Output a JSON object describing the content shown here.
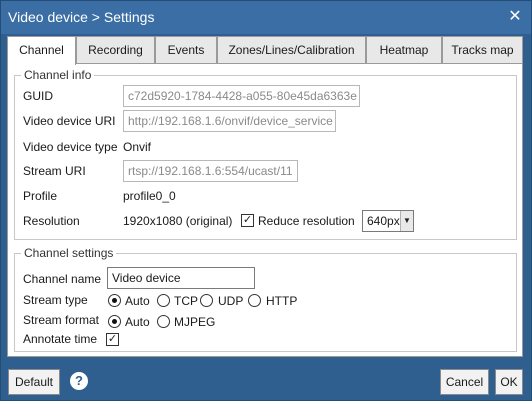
{
  "window": {
    "title": "Video device > Settings",
    "close_glyph": "✕"
  },
  "tabs": [
    {
      "label": "Channel",
      "active": true
    },
    {
      "label": "Recording",
      "active": false
    },
    {
      "label": "Events",
      "active": false
    },
    {
      "label": "Zones/Lines/Calibration",
      "active": false
    },
    {
      "label": "Heatmap",
      "active": false
    },
    {
      "label": "Tracks map",
      "active": false
    }
  ],
  "channel_info": {
    "title": "Channel info",
    "guid_label": "GUID",
    "guid_value": "c72d5920-1784-4428-a055-80e45da6363e",
    "uri_label": "Video device URI",
    "uri_value": "http://192.168.1.6/onvif/device_service",
    "type_label": "Video device type",
    "type_value": "Onvif",
    "stream_uri_label": "Stream URI",
    "stream_uri_value": "rtsp://192.168.1.6:554/ucast/11",
    "profile_label": "Profile",
    "profile_value": "profile0_0",
    "resolution_label": "Resolution",
    "resolution_value": "1920x1080 (original)",
    "reduce_label": "Reduce resolution",
    "reduce_checked": "✓",
    "reduce_value": "640px",
    "reduce_arrow": "▼"
  },
  "channel_settings": {
    "title": "Channel settings",
    "name_label": "Channel name",
    "name_value": "Video device",
    "stream_type_label": "Stream type",
    "stream_type_options": [
      "Auto",
      "TCP",
      "UDP",
      "HTTP"
    ],
    "stream_type_selected": "Auto",
    "stream_format_label": "Stream format",
    "stream_format_options": [
      "Auto",
      "MJPEG"
    ],
    "stream_format_selected": "Auto",
    "annotate_label": "Annotate time",
    "annotate_checked": "✓"
  },
  "footer": {
    "default_label": "Default",
    "help_glyph": "?",
    "cancel_label": "Cancel",
    "ok_label": "OK"
  },
  "colors": {
    "titlebar": "#3a6ea5",
    "frame": "#2f5f8e"
  }
}
